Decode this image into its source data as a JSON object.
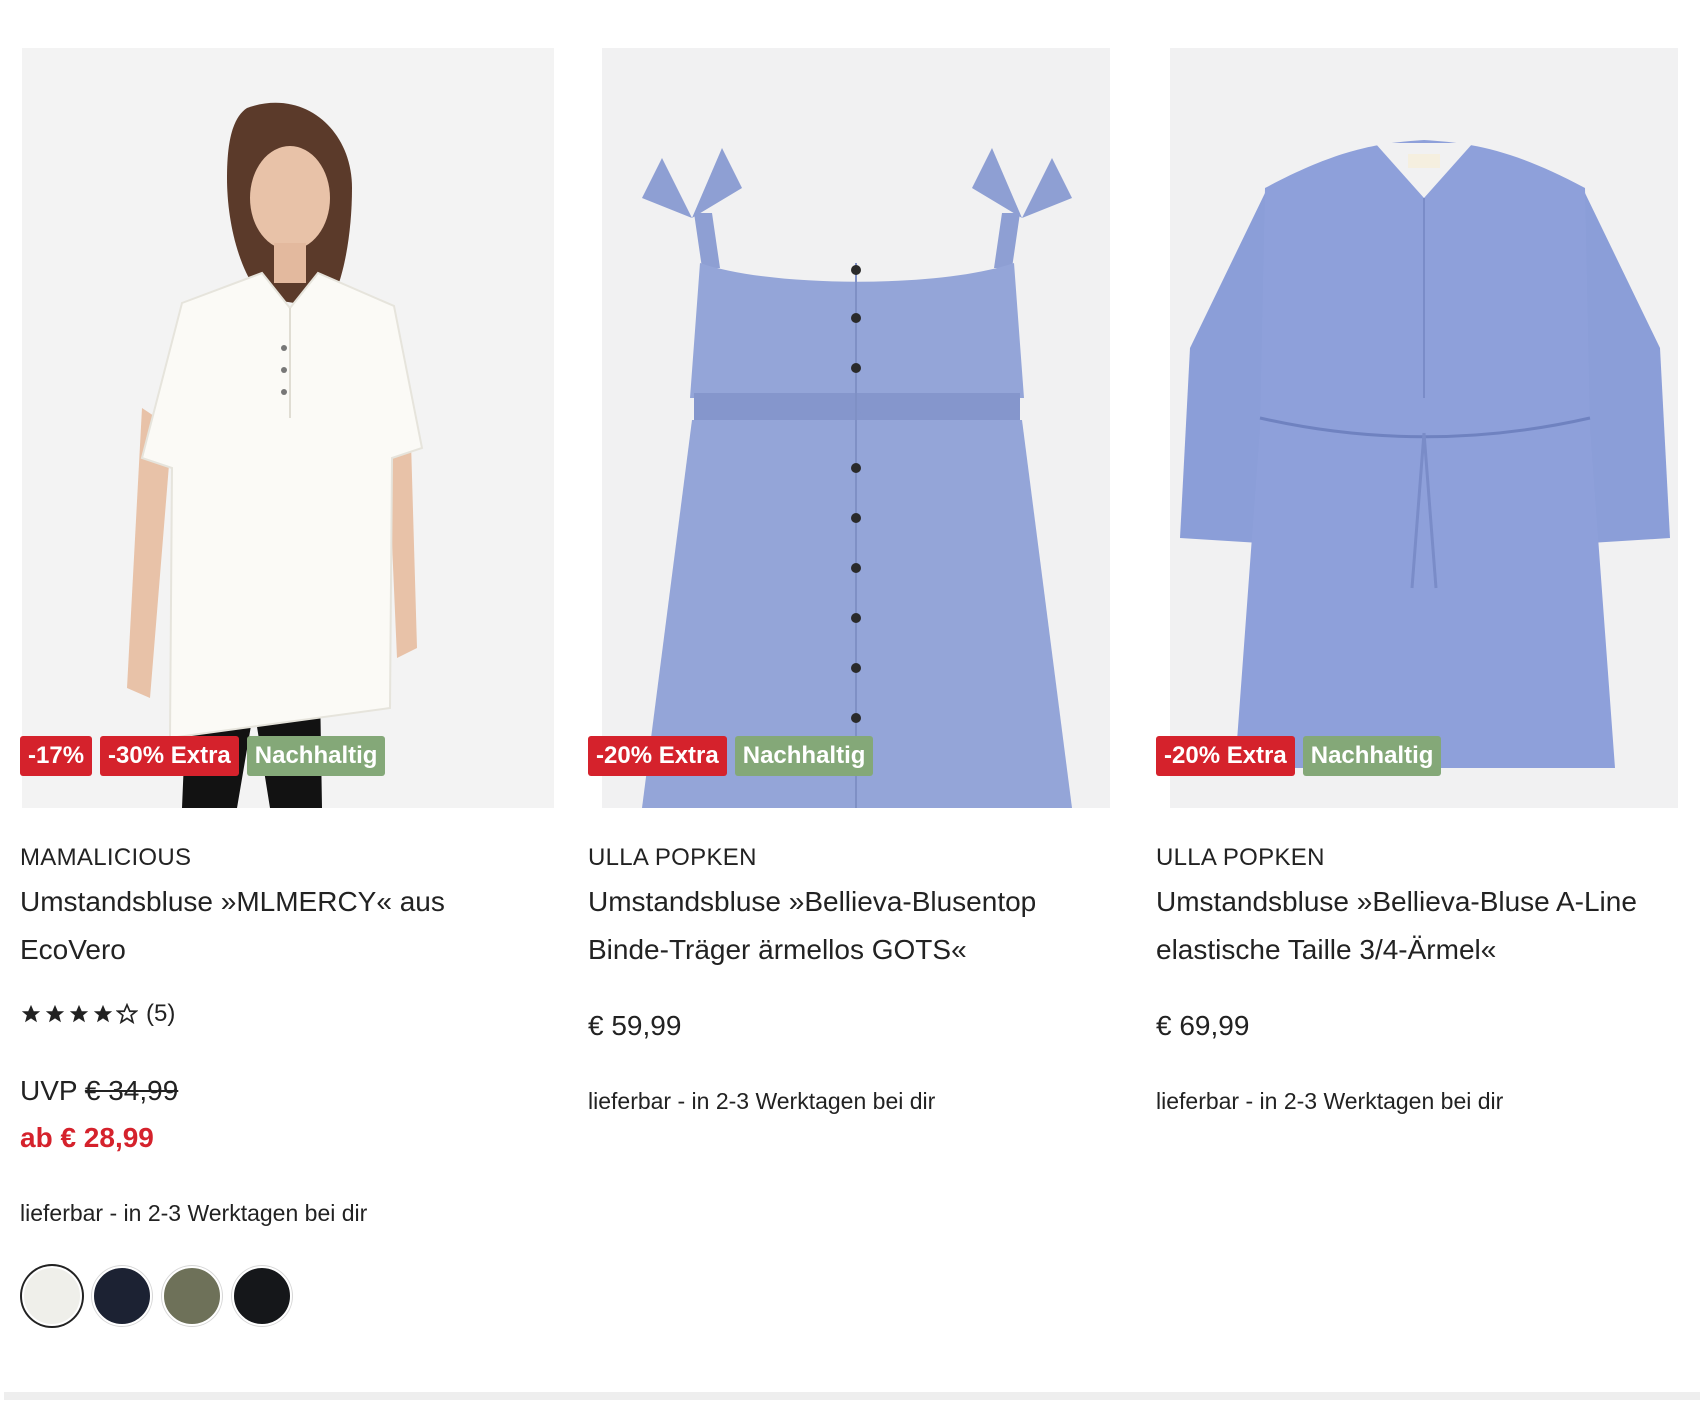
{
  "products": [
    {
      "brand": "MAMALICIOUS",
      "title": "Umstandsbluse »MLMERCY« aus EcoVero",
      "badges": [
        "-17%",
        "-30% Extra",
        "Nachhaltig"
      ],
      "rating": {
        "stars": 4,
        "max": 5,
        "count_label": "(5)"
      },
      "uvp_label": "UVP",
      "uvp_price": "€ 34,99",
      "sale_price": "ab € 28,99",
      "delivery": "lieferbar - in 2-3 Werktagen bei dir",
      "swatches": [
        {
          "name": "white",
          "color": "#efefea"
        },
        {
          "name": "navy",
          "color": "#1c2233"
        },
        {
          "name": "olive",
          "color": "#6e7159"
        },
        {
          "name": "black",
          "color": "#15171a"
        }
      ],
      "selected_swatch": 0
    },
    {
      "brand": "ULLA POPKEN",
      "title": "Umstandsbluse »Bellieva-Blusentop Binde-Träger ärmellos GOTS«",
      "badges": [
        "-20% Extra",
        "Nachhaltig"
      ],
      "price": "€ 59,99",
      "delivery": "lieferbar - in 2-3 Werktagen bei dir"
    },
    {
      "brand": "ULLA POPKEN",
      "title": "Umstandsbluse »Bellieva-Bluse A-Line elastische Taille 3/4-Ärmel«",
      "badges": [
        "-20% Extra",
        "Nachhaltig"
      ],
      "price": "€ 69,99",
      "delivery": "lieferbar - in 2-3 Werktagen bei dir"
    }
  ],
  "colors": {
    "sale_red": "#d5222c",
    "sustainable_green": "#84a878",
    "text": "#222222",
    "image_bg": "#f1f1f2",
    "chambray_blue": "#8e9fd3"
  }
}
